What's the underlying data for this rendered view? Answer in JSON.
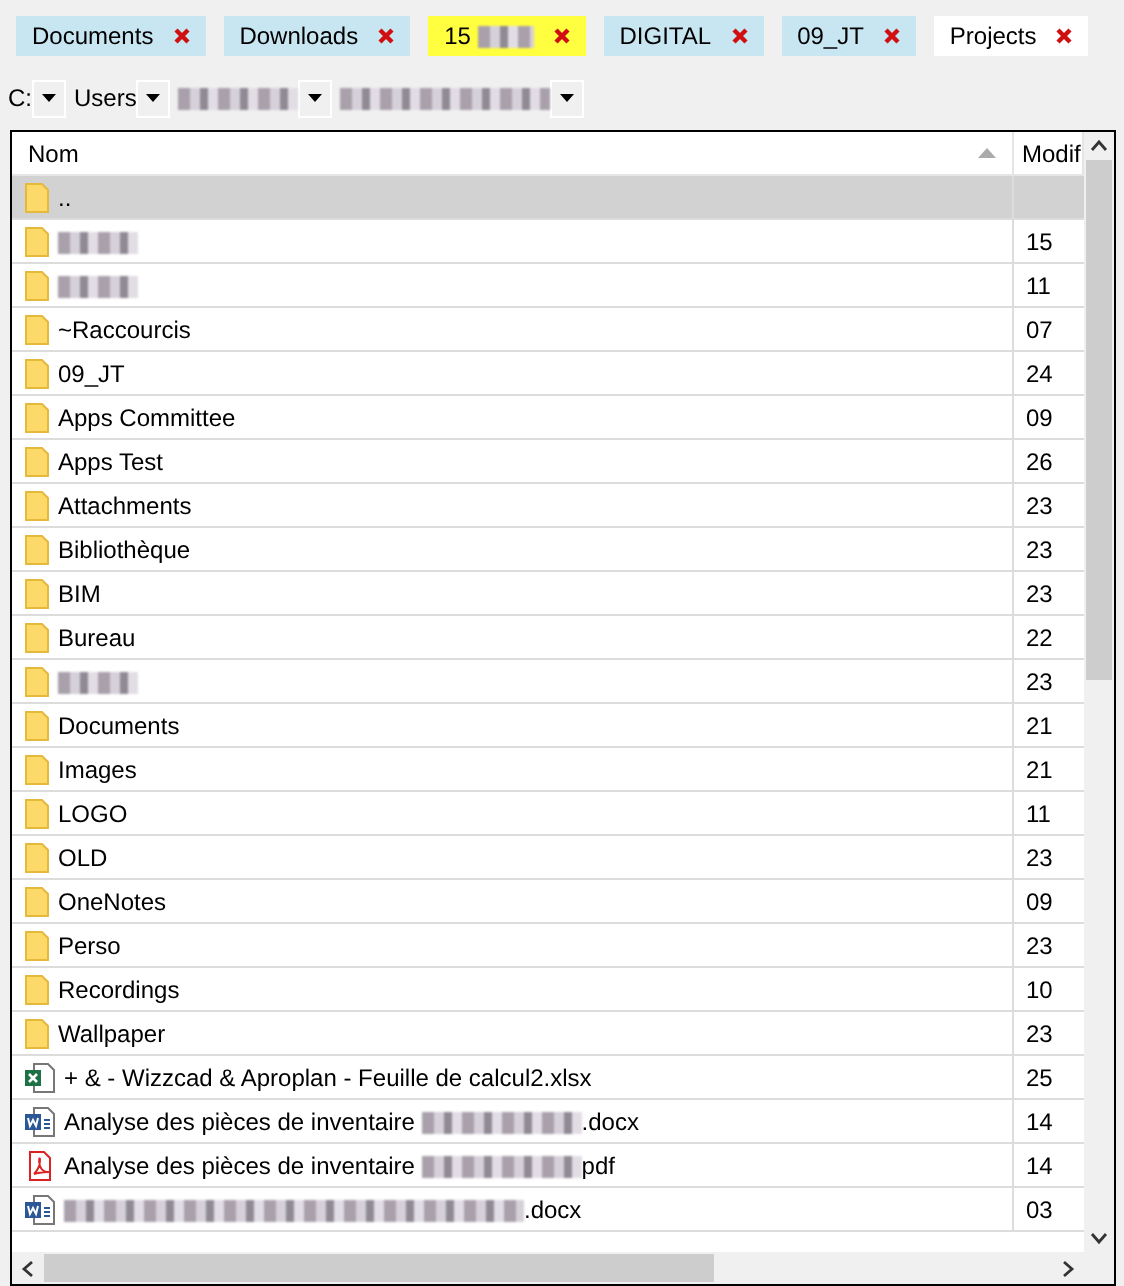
{
  "tabs": [
    {
      "label": [
        {
          "kind": "text",
          "text": "Documents"
        }
      ],
      "color": "#c8e6f2",
      "selected": false
    },
    {
      "label": [
        {
          "kind": "text",
          "text": "Downloads"
        }
      ],
      "color": "#c8e6f2",
      "selected": false
    },
    {
      "label": [
        {
          "kind": "text",
          "text": "15 "
        },
        {
          "kind": "redacted"
        }
      ],
      "color": "#ffff40",
      "selected": false
    },
    {
      "label": [
        {
          "kind": "text",
          "text": "DIGITAL"
        }
      ],
      "color": "#c8e6f2",
      "selected": false
    },
    {
      "label": [
        {
          "kind": "text",
          "text": "09_JT"
        }
      ],
      "color": "#c8e6f2",
      "selected": false
    },
    {
      "label": [
        {
          "kind": "text",
          "text": "Projects"
        }
      ],
      "selected": true
    }
  ],
  "breadcrumb": [
    {
      "label": [
        {
          "kind": "text",
          "text": "C:"
        }
      ]
    },
    {
      "label": [
        {
          "kind": "text",
          "text": "Users"
        }
      ]
    },
    {
      "label": [
        {
          "kind": "redacted"
        }
      ]
    },
    {
      "label": [
        {
          "kind": "redacted"
        }
      ]
    }
  ],
  "table": {
    "columns": [
      "Nom",
      "Modif"
    ],
    "rows": [
      {
        "kind": "folder",
        "name": [
          {
            "kind": "text",
            "text": ".."
          }
        ],
        "selected": true
      },
      {
        "kind": "folder",
        "name": [
          {
            "kind": "redacted"
          }
        ],
        "date": "15",
        "selected": false
      },
      {
        "kind": "folder",
        "name": [
          {
            "kind": "redacted"
          }
        ],
        "date": "11",
        "selected": false
      },
      {
        "kind": "folder",
        "name": [
          {
            "kind": "text",
            "text": "~Raccourcis"
          }
        ],
        "date": "07",
        "selected": false
      },
      {
        "kind": "folder",
        "name": [
          {
            "kind": "text",
            "text": "09_JT"
          }
        ],
        "date": "24",
        "selected": false
      },
      {
        "kind": "folder",
        "name": [
          {
            "kind": "text",
            "text": "Apps Committee"
          }
        ],
        "date": "09",
        "selected": false
      },
      {
        "kind": "folder",
        "name": [
          {
            "kind": "text",
            "text": "Apps Test"
          }
        ],
        "date": "26",
        "selected": false
      },
      {
        "kind": "folder",
        "name": [
          {
            "kind": "text",
            "text": "Attachments"
          }
        ],
        "date": "23",
        "selected": false
      },
      {
        "kind": "folder",
        "name": [
          {
            "kind": "text",
            "text": "Bibliothèque"
          }
        ],
        "date": "23",
        "selected": false
      },
      {
        "kind": "folder",
        "name": [
          {
            "kind": "text",
            "text": "BIM"
          }
        ],
        "date": "23",
        "selected": false
      },
      {
        "kind": "folder",
        "name": [
          {
            "kind": "text",
            "text": "Bureau"
          }
        ],
        "date": "22",
        "selected": false
      },
      {
        "kind": "folder",
        "name": [
          {
            "kind": "redacted"
          }
        ],
        "date": "23",
        "selected": false
      },
      {
        "kind": "folder",
        "name": [
          {
            "kind": "text",
            "text": "Documents"
          }
        ],
        "date": "21",
        "selected": false
      },
      {
        "kind": "folder",
        "name": [
          {
            "kind": "text",
            "text": "Images"
          }
        ],
        "date": "21",
        "selected": false
      },
      {
        "kind": "folder",
        "name": [
          {
            "kind": "text",
            "text": "LOGO"
          }
        ],
        "date": "11",
        "selected": false
      },
      {
        "kind": "folder",
        "name": [
          {
            "kind": "text",
            "text": "OLD"
          }
        ],
        "date": "23",
        "selected": false
      },
      {
        "kind": "folder",
        "name": [
          {
            "kind": "text",
            "text": "OneNotes"
          }
        ],
        "date": "09",
        "selected": false
      },
      {
        "kind": "folder",
        "name": [
          {
            "kind": "text",
            "text": "Perso"
          }
        ],
        "date": "23",
        "selected": false
      },
      {
        "kind": "folder",
        "name": [
          {
            "kind": "text",
            "text": "Recordings"
          }
        ],
        "date": "10",
        "selected": false
      },
      {
        "kind": "folder",
        "name": [
          {
            "kind": "text",
            "text": "Wallpaper"
          }
        ],
        "date": "23",
        "selected": false
      },
      {
        "kind": "excel",
        "name": [
          {
            "kind": "text",
            "text": "+ & - Wizzcad & Aproplan - Feuille de calcul2.xlsx"
          }
        ],
        "date": "25",
        "selected": false
      },
      {
        "kind": "word",
        "name": [
          {
            "kind": "text",
            "text": "Analyse des pièces de inventaire "
          },
          {
            "kind": "redacted"
          },
          {
            "kind": "text",
            "text": ".docx"
          }
        ],
        "date": "14",
        "selected": false
      },
      {
        "kind": "pdf",
        "name": [
          {
            "kind": "text",
            "text": "Analyse des pièces de inventaire "
          },
          {
            "kind": "redacted"
          },
          {
            "kind": "text",
            "text": "pdf"
          }
        ],
        "date": "14",
        "selected": false
      },
      {
        "kind": "word",
        "name": [
          {
            "kind": "redacted"
          },
          {
            "kind": "text",
            "text": ".docx"
          }
        ],
        "date": "03",
        "selected": false
      }
    ]
  }
}
